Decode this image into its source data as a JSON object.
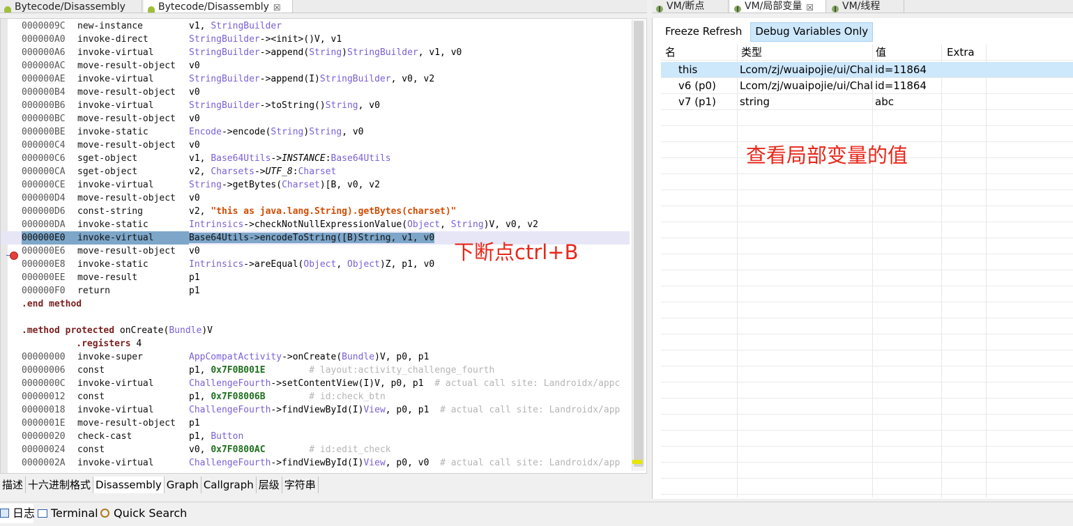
{
  "editor_tabs": [
    {
      "label": "Bytecode/Disassembly",
      "close": ""
    },
    {
      "label": "Bytecode/Disassembly",
      "close": "☒"
    }
  ],
  "right_tabs": [
    {
      "label": "VM/断点",
      "close": ""
    },
    {
      "label": "VM/局部变量",
      "close": "☒"
    },
    {
      "label": "VM/线程",
      "close": ""
    }
  ],
  "code_lines": [
    [
      {
        "t": "000009C",
        "c": "addr"
      },
      {
        "t": "new-instance",
        "c": "op"
      },
      {
        "t": "v1, ",
        "c": ""
      },
      {
        "t": "StringBuilder",
        "c": "cls"
      }
    ],
    [
      {
        "t": "00000A0",
        "c": "addr"
      },
      {
        "t": "invoke-direct",
        "c": "op"
      },
      {
        "t": "StringBuilder",
        "c": "cls"
      },
      {
        "t": "-><init>()V, v1",
        "c": ""
      }
    ],
    [
      {
        "t": "00000A6",
        "c": "addr"
      },
      {
        "t": "invoke-virtual",
        "c": "op"
      },
      {
        "t": "StringBuilder",
        "c": "cls"
      },
      {
        "t": "->append(",
        "c": ""
      },
      {
        "t": "String",
        "c": "cls"
      },
      {
        "t": ")",
        "c": ""
      },
      {
        "t": "StringBuilder",
        "c": "cls"
      },
      {
        "t": ", v1, v0",
        "c": ""
      }
    ],
    [
      {
        "t": "00000AC",
        "c": "addr"
      },
      {
        "t": "move-result-object",
        "c": "op"
      },
      {
        "t": "v0",
        "c": ""
      }
    ],
    [
      {
        "t": "00000AE",
        "c": "addr"
      },
      {
        "t": "invoke-virtual",
        "c": "op"
      },
      {
        "t": "StringBuilder",
        "c": "cls"
      },
      {
        "t": "->append(I)",
        "c": ""
      },
      {
        "t": "StringBuilder",
        "c": "cls"
      },
      {
        "t": ", v0, v2",
        "c": ""
      }
    ],
    [
      {
        "t": "00000B4",
        "c": "addr"
      },
      {
        "t": "move-result-object",
        "c": "op"
      },
      {
        "t": "v0",
        "c": ""
      }
    ],
    [
      {
        "t": "00000B6",
        "c": "addr"
      },
      {
        "t": "invoke-virtual",
        "c": "op"
      },
      {
        "t": "StringBuilder",
        "c": "cls"
      },
      {
        "t": "->toString()",
        "c": ""
      },
      {
        "t": "String",
        "c": "cls"
      },
      {
        "t": ", v0",
        "c": ""
      }
    ],
    [
      {
        "t": "00000BC",
        "c": "addr"
      },
      {
        "t": "move-result-object",
        "c": "op"
      },
      {
        "t": "v0",
        "c": ""
      }
    ],
    [
      {
        "t": "00000BE",
        "c": "addr"
      },
      {
        "t": "invoke-static",
        "c": "op"
      },
      {
        "t": "Encode",
        "c": "cls"
      },
      {
        "t": "->encode(",
        "c": ""
      },
      {
        "t": "String",
        "c": "cls"
      },
      {
        "t": ")",
        "c": ""
      },
      {
        "t": "String",
        "c": "cls"
      },
      {
        "t": ", v0",
        "c": ""
      }
    ],
    [
      {
        "t": "00000C4",
        "c": "addr"
      },
      {
        "t": "move-result-object",
        "c": "op"
      },
      {
        "t": "v0",
        "c": ""
      }
    ],
    [
      {
        "t": "00000C6",
        "c": "addr"
      },
      {
        "t": "sget-object",
        "c": "op"
      },
      {
        "t": "v1, ",
        "c": ""
      },
      {
        "t": "Base64Utils",
        "c": "cls"
      },
      {
        "t": "->",
        "c": ""
      },
      {
        "t": "INSTANCE",
        "c": "it"
      },
      {
        "t": ":",
        "c": ""
      },
      {
        "t": "Base64Utils",
        "c": "cls"
      }
    ],
    [
      {
        "t": "00000CA",
        "c": "addr"
      },
      {
        "t": "sget-object",
        "c": "op"
      },
      {
        "t": "v2, ",
        "c": ""
      },
      {
        "t": "Charsets",
        "c": "cls"
      },
      {
        "t": "->",
        "c": ""
      },
      {
        "t": "UTF_8",
        "c": "it"
      },
      {
        "t": ":",
        "c": ""
      },
      {
        "t": "Charset",
        "c": "cls"
      }
    ],
    [
      {
        "t": "00000CE",
        "c": "addr"
      },
      {
        "t": "invoke-virtual",
        "c": "op"
      },
      {
        "t": "String",
        "c": "cls"
      },
      {
        "t": "->getBytes(",
        "c": ""
      },
      {
        "t": "Charset",
        "c": "cls"
      },
      {
        "t": ")[B, v0, v2",
        "c": ""
      }
    ],
    [
      {
        "t": "00000D4",
        "c": "addr"
      },
      {
        "t": "move-result-object",
        "c": "op"
      },
      {
        "t": "v0",
        "c": ""
      }
    ],
    [
      {
        "t": "00000D6",
        "c": "addr"
      },
      {
        "t": "const-string",
        "c": "op"
      },
      {
        "t": "v2, ",
        "c": ""
      },
      {
        "t": "\"this as java.lang.String).getBytes(charset)\"",
        "c": "str"
      }
    ],
    [
      {
        "t": "00000DA",
        "c": "addr"
      },
      {
        "t": "invoke-static",
        "c": "op"
      },
      {
        "t": "Intrinsics",
        "c": "cls"
      },
      {
        "t": "->checkNotNullExpressionValue(",
        "c": ""
      },
      {
        "t": "Object",
        "c": "cls"
      },
      {
        "t": ", ",
        "c": ""
      },
      {
        "t": "String",
        "c": "cls"
      },
      {
        "t": ")V, v0, v2",
        "c": ""
      }
    ],
    [
      {
        "t": "00000E0",
        "c": "addr"
      },
      {
        "t": "invoke-virtual",
        "c": "op"
      },
      {
        "t": "Base64Utils->encodeToString([B)String, v1, v0",
        "c": "ops"
      }
    ],
    [
      {
        "t": "00000E6",
        "c": "addr"
      },
      {
        "t": "move-result-object",
        "c": "op"
      },
      {
        "t": "v0",
        "c": ""
      }
    ],
    [
      {
        "t": "00000E8",
        "c": "addr"
      },
      {
        "t": "invoke-static",
        "c": "op"
      },
      {
        "t": "Intrinsics",
        "c": "cls"
      },
      {
        "t": "->areEqual(",
        "c": ""
      },
      {
        "t": "Object",
        "c": "cls"
      },
      {
        "t": ", ",
        "c": ""
      },
      {
        "t": "Object",
        "c": "cls"
      },
      {
        "t": ")Z, p1, v0",
        "c": ""
      }
    ],
    [
      {
        "t": "00000EE",
        "c": "addr"
      },
      {
        "t": "move-result",
        "c": "op"
      },
      {
        "t": "p1",
        "c": ""
      }
    ],
    [
      {
        "t": "00000F0",
        "c": "addr"
      },
      {
        "t": "return",
        "c": "op"
      },
      {
        "t": "p1",
        "c": ""
      }
    ],
    [
      {
        "t": ".end method",
        "c": "kw"
      }
    ],
    [
      {
        "t": " ",
        "c": ""
      }
    ],
    [
      {
        "t": ".method protected",
        "c": "kw"
      },
      {
        "t": " onCreate(",
        "c": ""
      },
      {
        "t": "Bundle",
        "c": "cls"
      },
      {
        "t": ")V",
        "c": ""
      }
    ],
    [
      {
        "t": "          ",
        "c": ""
      },
      {
        "t": ".registers",
        "c": "kw"
      },
      {
        "t": " 4",
        "c": ""
      }
    ],
    [
      {
        "t": "0000000",
        "c": "addr"
      },
      {
        "t": "invoke-super",
        "c": "op"
      },
      {
        "t": "AppCompatActivity",
        "c": "cls"
      },
      {
        "t": "->onCreate(",
        "c": ""
      },
      {
        "t": "Bundle",
        "c": "cls"
      },
      {
        "t": ")V, p0, p1",
        "c": ""
      }
    ],
    [
      {
        "t": "0000006",
        "c": "addr"
      },
      {
        "t": "const",
        "c": "op"
      },
      {
        "t": "p1, ",
        "c": ""
      },
      {
        "t": "0x7F0B001E",
        "c": "num"
      },
      {
        "t": "        ",
        "c": ""
      },
      {
        "t": "# layout:activity_challenge_fourth",
        "c": "cmt"
      }
    ],
    [
      {
        "t": "000000C",
        "c": "addr"
      },
      {
        "t": "invoke-virtual",
        "c": "op"
      },
      {
        "t": "ChallengeFourth",
        "c": "cls"
      },
      {
        "t": "->setContentView(I)V, p0, p1  ",
        "c": ""
      },
      {
        "t": "# actual call site: Landroidx/appc",
        "c": "cmt"
      }
    ],
    [
      {
        "t": "0000012",
        "c": "addr"
      },
      {
        "t": "const",
        "c": "op"
      },
      {
        "t": "p1, ",
        "c": ""
      },
      {
        "t": "0x7F08006B",
        "c": "num"
      },
      {
        "t": "        ",
        "c": ""
      },
      {
        "t": "# id:check_btn",
        "c": "cmt"
      }
    ],
    [
      {
        "t": "0000018",
        "c": "addr"
      },
      {
        "t": "invoke-virtual",
        "c": "op"
      },
      {
        "t": "ChallengeFourth",
        "c": "cls"
      },
      {
        "t": "->findViewById(I)",
        "c": ""
      },
      {
        "t": "View",
        "c": "cls"
      },
      {
        "t": ", p0, p1  ",
        "c": ""
      },
      {
        "t": "# actual call site: Landroidx/app",
        "c": "cmt"
      }
    ],
    [
      {
        "t": "000001E",
        "c": "addr"
      },
      {
        "t": "move-result-object",
        "c": "op"
      },
      {
        "t": "p1",
        "c": ""
      }
    ],
    [
      {
        "t": "0000020",
        "c": "addr"
      },
      {
        "t": "check-cast",
        "c": "op"
      },
      {
        "t": "p1, ",
        "c": ""
      },
      {
        "t": "Button",
        "c": "cls"
      }
    ],
    [
      {
        "t": "0000024",
        "c": "addr"
      },
      {
        "t": "const",
        "c": "op"
      },
      {
        "t": "v0, ",
        "c": ""
      },
      {
        "t": "0x7F0800AC",
        "c": "num"
      },
      {
        "t": "        ",
        "c": ""
      },
      {
        "t": "# id:edit_check",
        "c": "cmt"
      }
    ],
    [
      {
        "t": "000002A",
        "c": "addr"
      },
      {
        "t": "invoke-virtual",
        "c": "op"
      },
      {
        "t": "ChallengeFourth",
        "c": "cls"
      },
      {
        "t": "->findViewById(I)",
        "c": ""
      },
      {
        "t": "View",
        "c": "cls"
      },
      {
        "t": ", p0, v0  ",
        "c": ""
      },
      {
        "t": "# actual call site: Landroidx/app",
        "c": "cmt"
      }
    ]
  ],
  "addr_prefix": "0",
  "breakpoint_line": 16,
  "annotations": {
    "breakpoint_note": "下断点ctrl+B",
    "vars_note": "查看局部变量的值"
  },
  "bottom_tabs": [
    "描述",
    "十六进制格式",
    "Disassembly",
    "Graph",
    "Callgraph",
    "层级",
    "字符串"
  ],
  "variables": {
    "freeze_label": "Freeze Refresh",
    "debug_only_label": "Debug Variables Only",
    "columns": [
      "名",
      "类型",
      "值",
      "Extra"
    ],
    "rows": [
      {
        "name": "this",
        "type": "Lcom/zj/wuaipojie/ui/Chal",
        "value": "id=11864",
        "extra": ""
      },
      {
        "name": "v6 (p0)",
        "type": "Lcom/zj/wuaipojie/ui/Chal",
        "value": "id=11864",
        "extra": ""
      },
      {
        "name": "v7 (p1)",
        "type": "string",
        "value": "abc",
        "extra": ""
      }
    ]
  },
  "footer_tabs": [
    "日志",
    "Terminal",
    "Quick Search"
  ],
  "colors": {
    "breakpoint": "#e2403a",
    "annotation": "#e8271a",
    "selection": "#cde7fb",
    "highlight": "#7da6c9"
  }
}
